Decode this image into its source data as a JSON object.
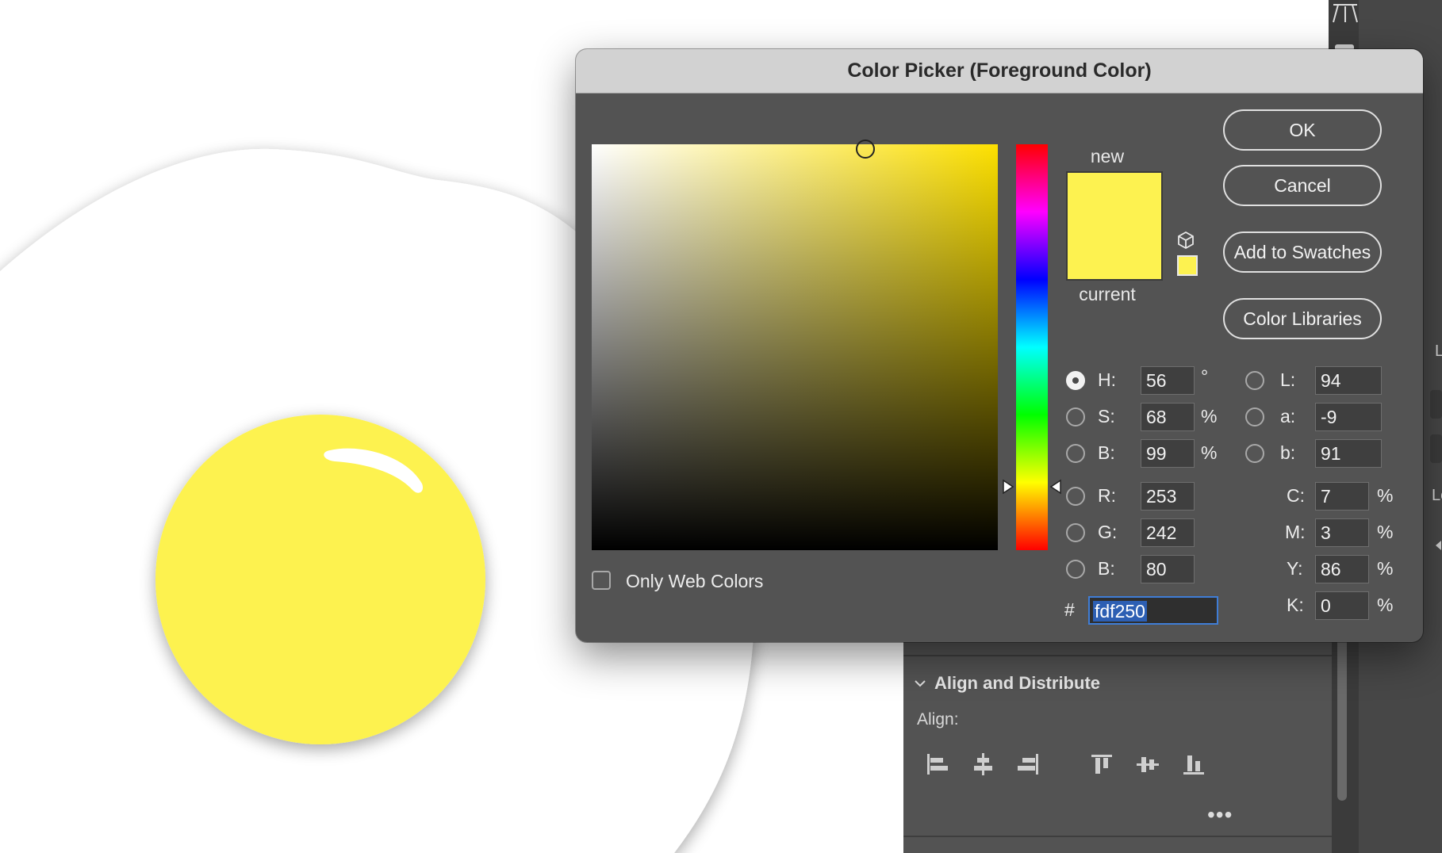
{
  "dialog": {
    "title": "Color Picker (Foreground Color)",
    "buttons": {
      "ok": "OK",
      "cancel": "Cancel",
      "add_to_swatches": "Add to Swatches",
      "color_libraries": "Color Libraries"
    },
    "swatch": {
      "new_label": "new",
      "current_label": "current",
      "new_color": "#fdf250",
      "current_color": "#fdf250"
    },
    "hsb": [
      {
        "key": "h",
        "label": "H:",
        "value": "56",
        "unit": "°",
        "selected": true
      },
      {
        "key": "s",
        "label": "S:",
        "value": "68",
        "unit": "%",
        "selected": false
      },
      {
        "key": "b",
        "label": "B:",
        "value": "99",
        "unit": "%",
        "selected": false
      }
    ],
    "rgb": [
      {
        "key": "r",
        "label": "R:",
        "value": "253"
      },
      {
        "key": "g",
        "label": "G:",
        "value": "242"
      },
      {
        "key": "b",
        "label": "B:",
        "value": "80"
      }
    ],
    "lab": [
      {
        "key": "l",
        "label": "L:",
        "value": "94"
      },
      {
        "key": "a",
        "label": "a:",
        "value": "-9"
      },
      {
        "key": "b",
        "label": "b:",
        "value": "91"
      }
    ],
    "cmyk": [
      {
        "key": "c",
        "label": "C:",
        "value": "7",
        "unit": "%"
      },
      {
        "key": "m",
        "label": "M:",
        "value": "3",
        "unit": "%"
      },
      {
        "key": "y",
        "label": "Y:",
        "value": "86",
        "unit": "%"
      },
      {
        "key": "k",
        "label": "K:",
        "value": "0",
        "unit": "%"
      }
    ],
    "hex": {
      "prefix": "#",
      "value": "fdf250"
    },
    "only_web_colors": {
      "label": "Only Web Colors",
      "checked": false
    },
    "hue_slider_level": 0.844
  },
  "panel": {
    "align_section_title": "Align and Distribute",
    "align_label": "Align:",
    "more_label": "•••",
    "strip_fragments": [
      "L",
      "Lo"
    ]
  },
  "colors": {
    "egg_yolk": "#fdf250",
    "egg_white": "#ffffff",
    "dialog_bg": "#535353",
    "accent": "#3f7dd6"
  },
  "icons": {
    "align_buttons": [
      "align-left-edges-icon",
      "align-horizontal-centers-icon",
      "align-right-edges-icon",
      "align-top-edges-icon",
      "align-vertical-centers-icon",
      "align-bottom-edges-icon"
    ]
  }
}
